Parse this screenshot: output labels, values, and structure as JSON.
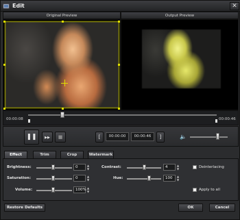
{
  "window": {
    "title": "Edit"
  },
  "preview": {
    "original_label": "Original Preview",
    "output_label": "Output Preview"
  },
  "timeline": {
    "start_time": "00:00:08",
    "end_time": "00:00:46",
    "position_fraction": 0.18
  },
  "controls": {
    "play_pause_glyph": "❚❚",
    "forward_glyph": "▶▶",
    "stop_glyph": "■",
    "start_time_value": "00:00:00",
    "end_time_value": "00:00:46",
    "volume_fraction": 0.72
  },
  "tabs": [
    {
      "label": "Effect",
      "active": true
    },
    {
      "label": "Trim",
      "active": false
    },
    {
      "label": "Crop",
      "active": false
    },
    {
      "label": "Watermark",
      "active": false
    }
  ],
  "effect": {
    "brightness": {
      "label": "Brightness:",
      "value": "0"
    },
    "saturation": {
      "label": "Saturation:",
      "value": "0"
    },
    "volume": {
      "label": "Volume:",
      "value": "100%"
    },
    "contrast": {
      "label": "Contrast:",
      "value": "4"
    },
    "hue": {
      "label": "Hue:",
      "value": "100"
    },
    "deinterlacing_label": "Deinterlacing",
    "apply_to_all_label": "Apply to all"
  },
  "footer": {
    "restore_label": "Restore Defaults",
    "ok_label": "OK",
    "cancel_label": "Cancel"
  },
  "colors": {
    "selection": "#e0e000",
    "background": "#2b2c2e"
  },
  "icons": [
    "app-icon",
    "close-icon",
    "play-pause-icon",
    "forward-icon",
    "stop-icon",
    "set-start-icon",
    "set-end-icon",
    "volume-icon"
  ]
}
